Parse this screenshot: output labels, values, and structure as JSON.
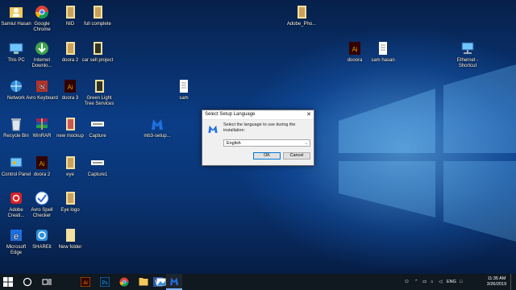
{
  "desktop_icons": [
    {
      "label": "Samiul Hasan",
      "icon": "user-folder-icon"
    },
    {
      "label": "Google Chrome",
      "icon": "chrome-icon"
    },
    {
      "label": "NID",
      "icon": "folder-icon"
    },
    {
      "label": "full complete",
      "icon": "folder-icon"
    },
    {
      "label": "Adobe_Pho...",
      "icon": "folder-icon"
    },
    {
      "label": "This PC",
      "icon": "computer-icon"
    },
    {
      "label": "Internet Downlo...",
      "icon": "idm-icon"
    },
    {
      "label": "doora 2",
      "icon": "folder-icon"
    },
    {
      "label": "car sell project",
      "icon": "folder-icon"
    },
    {
      "label": "dooora",
      "icon": "illustrator-icon"
    },
    {
      "label": "sam hasan",
      "icon": "document-icon"
    },
    {
      "label": "Ethernet - Shortcut",
      "icon": "network-icon"
    },
    {
      "label": "Network",
      "icon": "network-icon"
    },
    {
      "label": "Avro Keyboard",
      "icon": "avro-icon"
    },
    {
      "label": "doora 3",
      "icon": "illustrator-icon"
    },
    {
      "label": "Green Light Tree Services",
      "icon": "folder-icon"
    },
    {
      "label": "sam",
      "icon": "document-icon"
    },
    {
      "label": "Recycle Bin",
      "icon": "recycle-bin-icon"
    },
    {
      "label": "WinRAR",
      "icon": "winrar-icon"
    },
    {
      "label": "new mockup",
      "icon": "folder-icon"
    },
    {
      "label": "Capture",
      "icon": "image-icon"
    },
    {
      "label": "mb3-setup...",
      "icon": "malwarebytes-icon"
    },
    {
      "label": "Control Panel",
      "icon": "control-panel-icon"
    },
    {
      "label": "doora 2",
      "icon": "illustrator-icon"
    },
    {
      "label": "eye",
      "icon": "folder-icon"
    },
    {
      "label": "Capture1",
      "icon": "image-icon"
    },
    {
      "label": "Adobe Creati...",
      "icon": "creative-cloud-icon"
    },
    {
      "label": "Avro Spell Checker",
      "icon": "checkmark-icon"
    },
    {
      "label": "Eye logo",
      "icon": "folder-icon"
    },
    {
      "label": "Microsoft Edge",
      "icon": "edge-icon"
    },
    {
      "label": "SHAREit",
      "icon": "shareit-icon"
    },
    {
      "label": "New folder",
      "icon": "folder-icon"
    }
  ],
  "dialog": {
    "title": "Select Setup Language",
    "message": "Select the language to use during the installation:",
    "language_value": "English",
    "ok_label": "OK",
    "cancel_label": "Cancel"
  },
  "taskbar": {
    "items": [
      "start-icon",
      "search-icon",
      "task-view-icon",
      "illustrator-icon",
      "photoshop-icon",
      "chrome-icon",
      "file-explorer-icon",
      "word-icon",
      "photos-icon",
      "malwarebytes-icon"
    ],
    "tray_lang": "ENG",
    "time": "11:35 AM",
    "date": "3/26/2019"
  }
}
